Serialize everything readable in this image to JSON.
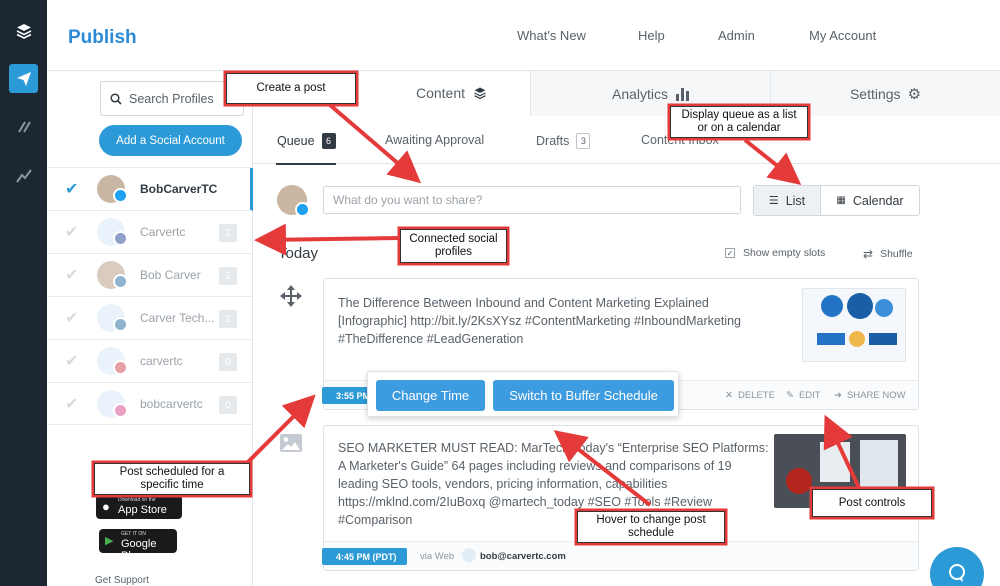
{
  "header": {
    "brand": "Publish",
    "nav": [
      "What's New",
      "Help",
      "Admin",
      "My Account"
    ]
  },
  "rail": {
    "icons": [
      "layers-icon",
      "paper-plane-icon",
      "reply-icon",
      "analytics-line-icon"
    ]
  },
  "sidebar": {
    "search_placeholder": "Search Profiles",
    "add_account": "Add a Social Account",
    "profiles": [
      {
        "name": "BobCarverTC",
        "network": "twitter",
        "count": "",
        "active": true
      },
      {
        "name": "Carvertc",
        "network": "facebook",
        "count": "2",
        "active": false
      },
      {
        "name": "Bob Carver",
        "network": "linkedin",
        "count": "2",
        "active": false
      },
      {
        "name": "Carver Tech...",
        "network": "linkedin",
        "count": "2",
        "active": false
      },
      {
        "name": "carvertc",
        "network": "pinterest",
        "count": "0",
        "active": false
      },
      {
        "name": "bobcarvertc",
        "network": "instagram",
        "count": "0",
        "active": false
      }
    ],
    "app_store": {
      "small": "Download on the",
      "big": "App Store"
    },
    "google_play": {
      "small": "GET IT ON",
      "big": "Google Play"
    },
    "get_support": "Get Support"
  },
  "main": {
    "tabs": [
      "Content",
      "Analytics",
      "Settings"
    ],
    "subtabs": [
      {
        "label": "Queue",
        "count": "6"
      },
      {
        "label": "Awaiting Approval",
        "count": ""
      },
      {
        "label": "Drafts",
        "count": "3"
      },
      {
        "label": "Content Inbox",
        "count": ""
      }
    ],
    "composer_placeholder": "What do you want to share?",
    "view_list": "List",
    "view_calendar": "Calendar",
    "today": "Today",
    "show_empty_slots": "Show empty slots",
    "shuffle": "Shuffle",
    "posts": [
      {
        "lines": [
          "The Difference Between Inbound and Content Marketing Explained",
          "[Infographic] http://bit.ly/2KsXYsz #ContentMarketing #InboundMarketing",
          "#TheDifference #LeadGeneration"
        ],
        "time": "3:55 PM",
        "actions": [
          "DELETE",
          "EDIT",
          "SHARE NOW"
        ]
      },
      {
        "lines": [
          "SEO MARKETER MUST READ: MarTech Today's “Enterprise SEO Platforms:",
          "A Marketer's Guide” 64 pages including reviews and comparisons of 19",
          "leading SEO tools, vendors, pricing information, capabilities",
          "https://mklnd.com/2IuBoxq @martech_today #SEO #Tools #Review",
          "#Comparison"
        ],
        "time": "4:45 PM (PDT)",
        "via": "via Web",
        "author": "bob@carvertc.com"
      }
    ],
    "hover": {
      "change_time": "Change Time",
      "switch": "Switch to Buffer Schedule"
    }
  },
  "callouts": {
    "create_post": "Create a post",
    "display_queue": "Display queue as a list or on a calendar",
    "connected": "Connected social profiles",
    "scheduled": "Post scheduled for a specific time",
    "hover": "Hover to change post schedule",
    "controls": "Post controls"
  }
}
